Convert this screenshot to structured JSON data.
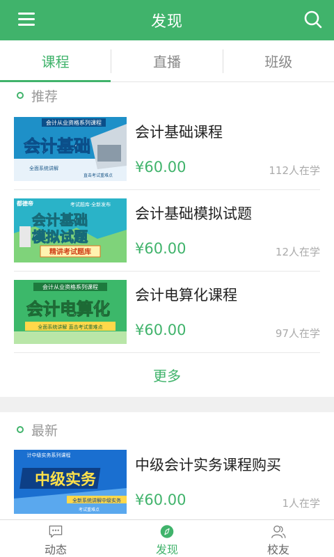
{
  "header": {
    "title": "发现",
    "menu_icon": "menu-icon",
    "search_icon": "search-icon",
    "color": "#40b36b"
  },
  "tabs": [
    {
      "label": "课程",
      "active": true
    },
    {
      "label": "直播",
      "active": false
    },
    {
      "label": "班级",
      "active": false
    }
  ],
  "recommended": {
    "heading": "推荐",
    "items": [
      {
        "name": "会计基础课程",
        "price": "¥60.00",
        "learners": "112人在学",
        "thumb": {
          "top": "会计从业资格系列课程",
          "main": "会计基础",
          "sub": "全面系统讲解",
          "sub2": "直击考试重难点",
          "bg": "#1e90c8"
        }
      },
      {
        "name": "会计基础模拟试题",
        "price": "¥60.00",
        "learners": "12人在学",
        "thumb": {
          "top": "考试题库·全新发布",
          "main": "会计基础",
          "main2": "模拟试题",
          "sub": "精讲考试题库",
          "logo": "都德帝",
          "bg": "#2ab3c8"
        }
      },
      {
        "name": "会计电算化课程",
        "price": "¥60.00",
        "learners": "97人在学",
        "thumb": {
          "top": "会计从业资格系列课程",
          "main": "会计电算化",
          "sub": "全面系统讲解 直击考试重难点",
          "bg": "#3cb86a"
        }
      }
    ],
    "more_label": "更多"
  },
  "latest": {
    "heading": "最新",
    "items": [
      {
        "name": "中级会计实务课程购买",
        "price": "¥60.00",
        "learners": "1人在学",
        "thumb": {
          "top": "计中级实务系列课程",
          "main": "中级实务",
          "sub": "全新系统讲解中级实务",
          "sub2": "考试重难点",
          "bg": "#1a6fd0"
        }
      }
    ]
  },
  "bottom_nav": [
    {
      "label": "动态",
      "icon": "chat-bubble-icon",
      "active": false
    },
    {
      "label": "发现",
      "icon": "compass-icon",
      "active": true
    },
    {
      "label": "校友",
      "icon": "people-icon",
      "active": false
    }
  ]
}
